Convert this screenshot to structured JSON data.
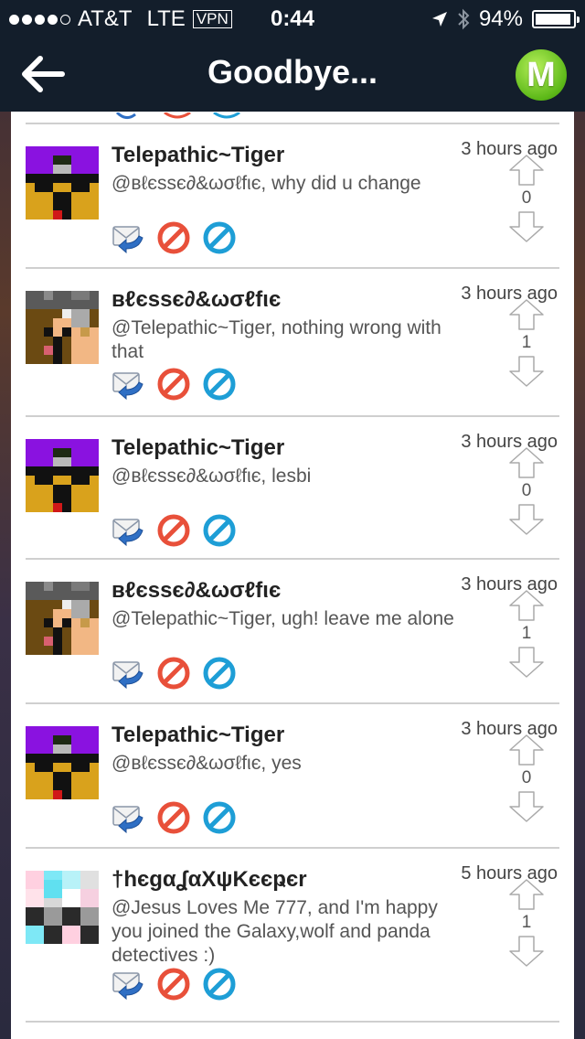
{
  "status_bar": {
    "carrier": "AT&T",
    "network": "LTE",
    "vpn": "VPN",
    "time": "0:44",
    "battery": "94%",
    "battery_level": 0.94,
    "signal_bars": 4
  },
  "nav": {
    "title": "Goodbye...",
    "logo_letter": "M"
  },
  "colors": {
    "nav_bg": "#131e2b",
    "logo_green": "#5cb818",
    "reply_blue": "#2f6fc4",
    "block_red": "#e8503a",
    "mod_blue": "#1e9ed6"
  },
  "comments": [
    {
      "author": "Telepathic~Tiger",
      "time": "3 hours ago",
      "text": "@ʙℓєѕѕє∂&ωσℓfιє, why did u change",
      "votes": "0",
      "avatar": "tiger"
    },
    {
      "author": "ʙℓєѕѕє∂&ωσℓfιє",
      "time": "3 hours ago",
      "text": "@Telepathic~Tiger, nothing wrong with that",
      "votes": "1",
      "avatar": "wolfie"
    },
    {
      "author": "Telepathic~Tiger",
      "time": "3 hours ago",
      "text": "@ʙℓєѕѕє∂&ωσℓfιє, lesbi",
      "votes": "0",
      "avatar": "tiger"
    },
    {
      "author": "ʙℓєѕѕє∂&ωσℓfιє",
      "time": "3 hours ago",
      "text": "@Telepathic~Tiger, ugh! leave me alone",
      "votes": "1",
      "avatar": "wolfie"
    },
    {
      "author": "Telepathic~Tiger",
      "time": "3 hours ago",
      "text": "@ʙℓєѕѕє∂&ωσℓfιє, yes",
      "votes": "0",
      "avatar": "tiger"
    },
    {
      "author": "†hєgαʆαXψKєєҏєr",
      "time": "5 hours ago",
      "text": "@Jesus Loves Me 777, and I'm happy you joined the Galaxy,wolf and panda detectives :)",
      "votes": "1",
      "avatar": "galaxy"
    }
  ]
}
